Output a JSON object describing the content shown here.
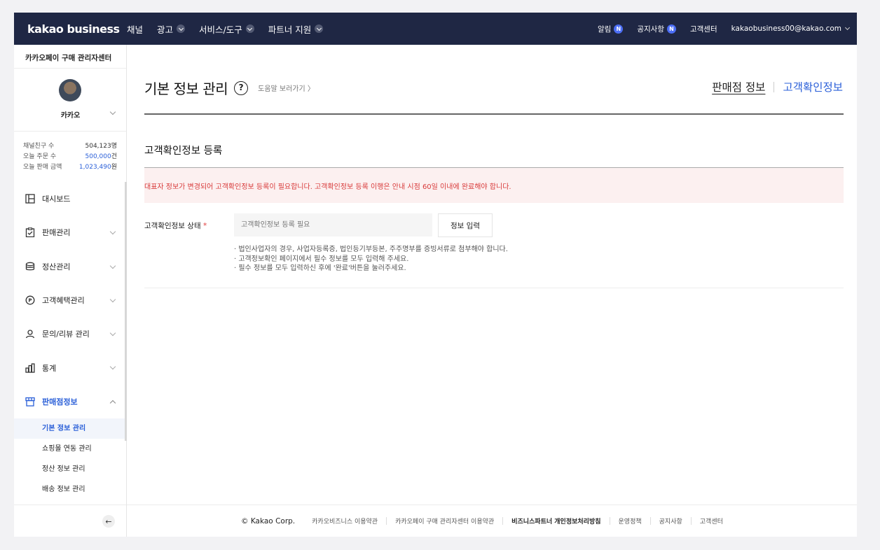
{
  "topnav": {
    "brand": "kakao business",
    "menu": [
      {
        "label": "채널",
        "dropdown": false
      },
      {
        "label": "광고",
        "dropdown": true
      },
      {
        "label": "서비스/도구",
        "dropdown": true
      },
      {
        "label": "파트너 지원",
        "dropdown": true
      }
    ],
    "notifications": "알림",
    "notice": "공지사항",
    "badge": "N",
    "support": "고객센터",
    "account": "kakaobusiness00@kakao.com"
  },
  "sidebar": {
    "title": "카카오페이 구매 관리자센터",
    "profile_name": "카카오",
    "stats": [
      {
        "label": "채널친구 수",
        "value": "504,123",
        "unit": "명"
      },
      {
        "label": "오늘 주문 수",
        "value": "500,000",
        "unit": "건"
      },
      {
        "label": "오늘 판매 금액",
        "value": "1,023,490",
        "unit": "원"
      }
    ],
    "nav": [
      {
        "label": "대시보드",
        "icon": "dashboard-icon"
      },
      {
        "label": "판매관리",
        "icon": "clipboard-check-icon"
      },
      {
        "label": "정산관리",
        "icon": "database-icon"
      },
      {
        "label": "고객혜택관리",
        "icon": "point-icon"
      },
      {
        "label": "문의/리뷰 관리",
        "icon": "person-icon"
      },
      {
        "label": "통계",
        "icon": "bar-chart-icon"
      },
      {
        "label": "판매점정보",
        "icon": "store-icon"
      }
    ],
    "subnav": [
      "기본 정보 관리",
      "쇼핑몰 연동 관리",
      "정산 정보 관리",
      "배송 정보 관리"
    ]
  },
  "main": {
    "page_title": "기본 정보 관리",
    "help_icon": "?",
    "help_link": "도움말 보러가기 〉",
    "tab_store": "판매점 정보",
    "tab_customer": "고객확인정보",
    "section_title": "고객확인정보 등록",
    "alert": "대표자 정보가 변경되어 고객확인정보 등록이 필요합니다. 고객확인정보 등록 이행은 안내 시점 60일 이내에 완료해야 합니다.",
    "field_label": "고객확인정보 상태",
    "required_mark": "*",
    "field_placeholder": "고객확인정보 등록 필요",
    "field_button": "정보 입력",
    "notes": [
      "법인사업자의 경우, 사업자등록증, 법인등기부등본, 주주명부를 증빙서류로 첨부해야 합니다.",
      "고객정보확인 페이지에서 필수 정보를 모두 입력해 주세요.",
      "필수 정보를 모두 입력하신 후에 '완료'버튼을 눌러주세요."
    ]
  },
  "footer": {
    "copyright": "© Kakao Corp.",
    "links": [
      "카카오비즈니스 이용약관",
      "카카오페이 구매 관리자센터 이용약관",
      "비즈니스파트너 개인정보처리방침",
      "운영정책",
      "공지사항",
      "고객센터"
    ]
  }
}
